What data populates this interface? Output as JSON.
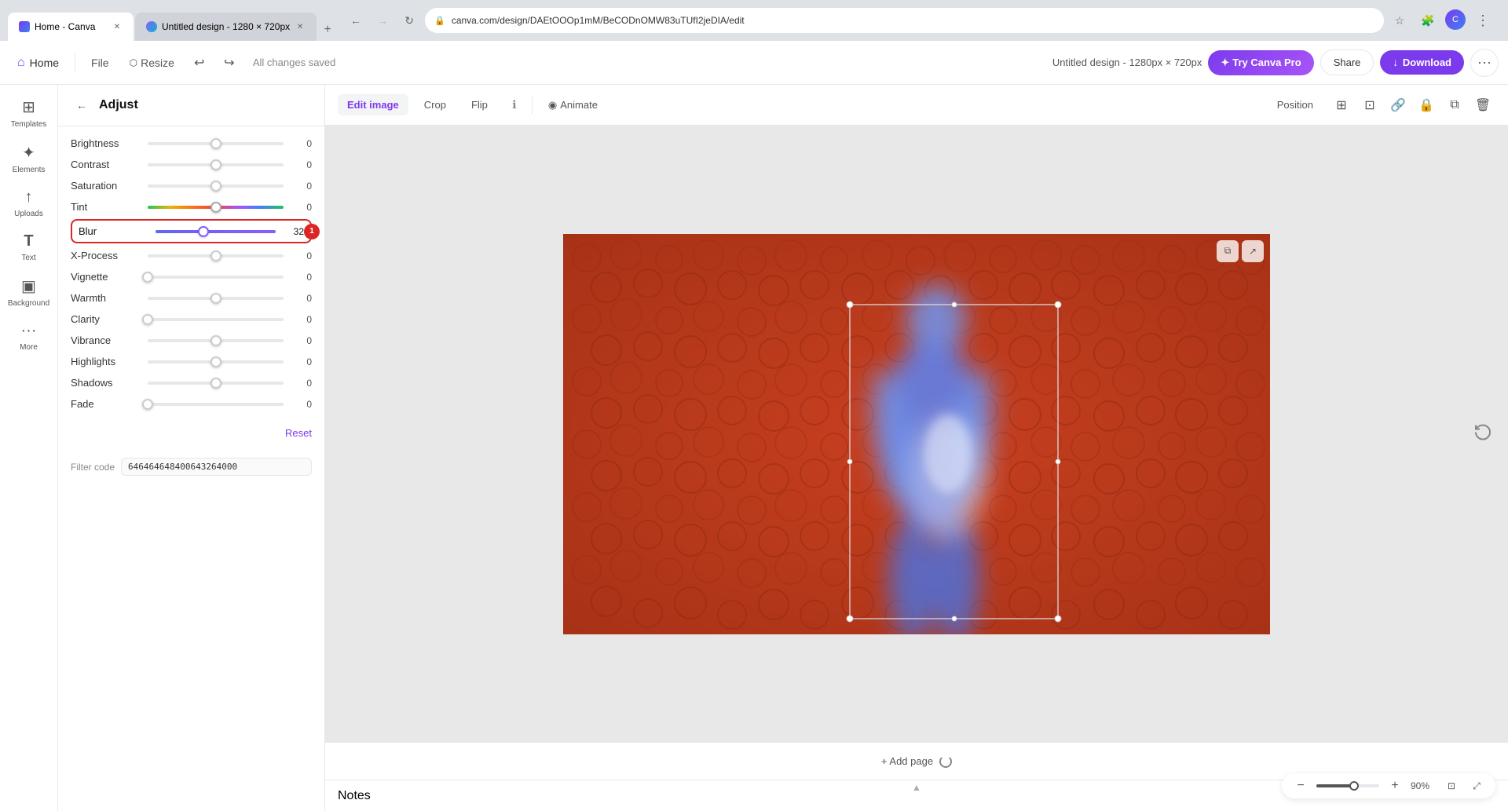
{
  "browser": {
    "tabs": [
      {
        "label": "Home - Canva",
        "active": true,
        "favicon": "canva"
      },
      {
        "label": "Untitled design - 1280 × 720px",
        "active": false,
        "favicon": "canva2"
      }
    ],
    "url": "canva.com/design/DAEtOOOp1mM/BeCODnOMW83uTUfI2jeDIA/edit"
  },
  "topbar": {
    "home_label": "Home",
    "file_label": "File",
    "resize_label": "Resize",
    "saved_text": "All changes saved",
    "design_title": "Untitled design - 1280px × 720px",
    "try_pro_label": "Try Canva Pro",
    "share_label": "Share",
    "download_label": "Download"
  },
  "sidebar": {
    "items": [
      {
        "label": "Templates",
        "icon": "⊞"
      },
      {
        "label": "Elements",
        "icon": "✦"
      },
      {
        "label": "Uploads",
        "icon": "↑"
      },
      {
        "label": "Text",
        "icon": "T"
      },
      {
        "label": "Background",
        "icon": "▣"
      },
      {
        "label": "More",
        "icon": "···"
      }
    ]
  },
  "adjust_panel": {
    "title": "Adjust",
    "back_label": "←",
    "sliders": [
      {
        "label": "Brightness",
        "value": 0,
        "percent": 50
      },
      {
        "label": "Contrast",
        "value": 0,
        "percent": 50
      },
      {
        "label": "Saturation",
        "value": 0,
        "percent": 50
      },
      {
        "label": "Tint",
        "value": 0,
        "percent": 50,
        "rainbow": true
      },
      {
        "label": "Blur",
        "value": 32,
        "percent": 40,
        "highlighted": true
      },
      {
        "label": "X-Process",
        "value": 0,
        "percent": 50
      },
      {
        "label": "Vignette",
        "value": 0,
        "percent": 0
      },
      {
        "label": "Warmth",
        "value": 0,
        "percent": 50
      },
      {
        "label": "Clarity",
        "value": 0,
        "percent": 0
      },
      {
        "label": "Vibrance",
        "value": 0,
        "percent": 50
      },
      {
        "label": "Highlights",
        "value": 0,
        "percent": 50
      },
      {
        "label": "Shadows",
        "value": 0,
        "percent": 50
      },
      {
        "label": "Fade",
        "value": 0,
        "percent": 0
      }
    ],
    "reset_label": "Reset",
    "filter_code_label": "Filter code",
    "filter_code_value": "646464648400643264000"
  },
  "toolbar": {
    "edit_image_label": "Edit image",
    "crop_label": "Crop",
    "flip_label": "Flip",
    "animate_label": "Animate",
    "position_label": "Position"
  },
  "canvas": {
    "add_page_label": "+ Add page",
    "zoom_level": "90%"
  },
  "notes": {
    "label": "Notes"
  }
}
